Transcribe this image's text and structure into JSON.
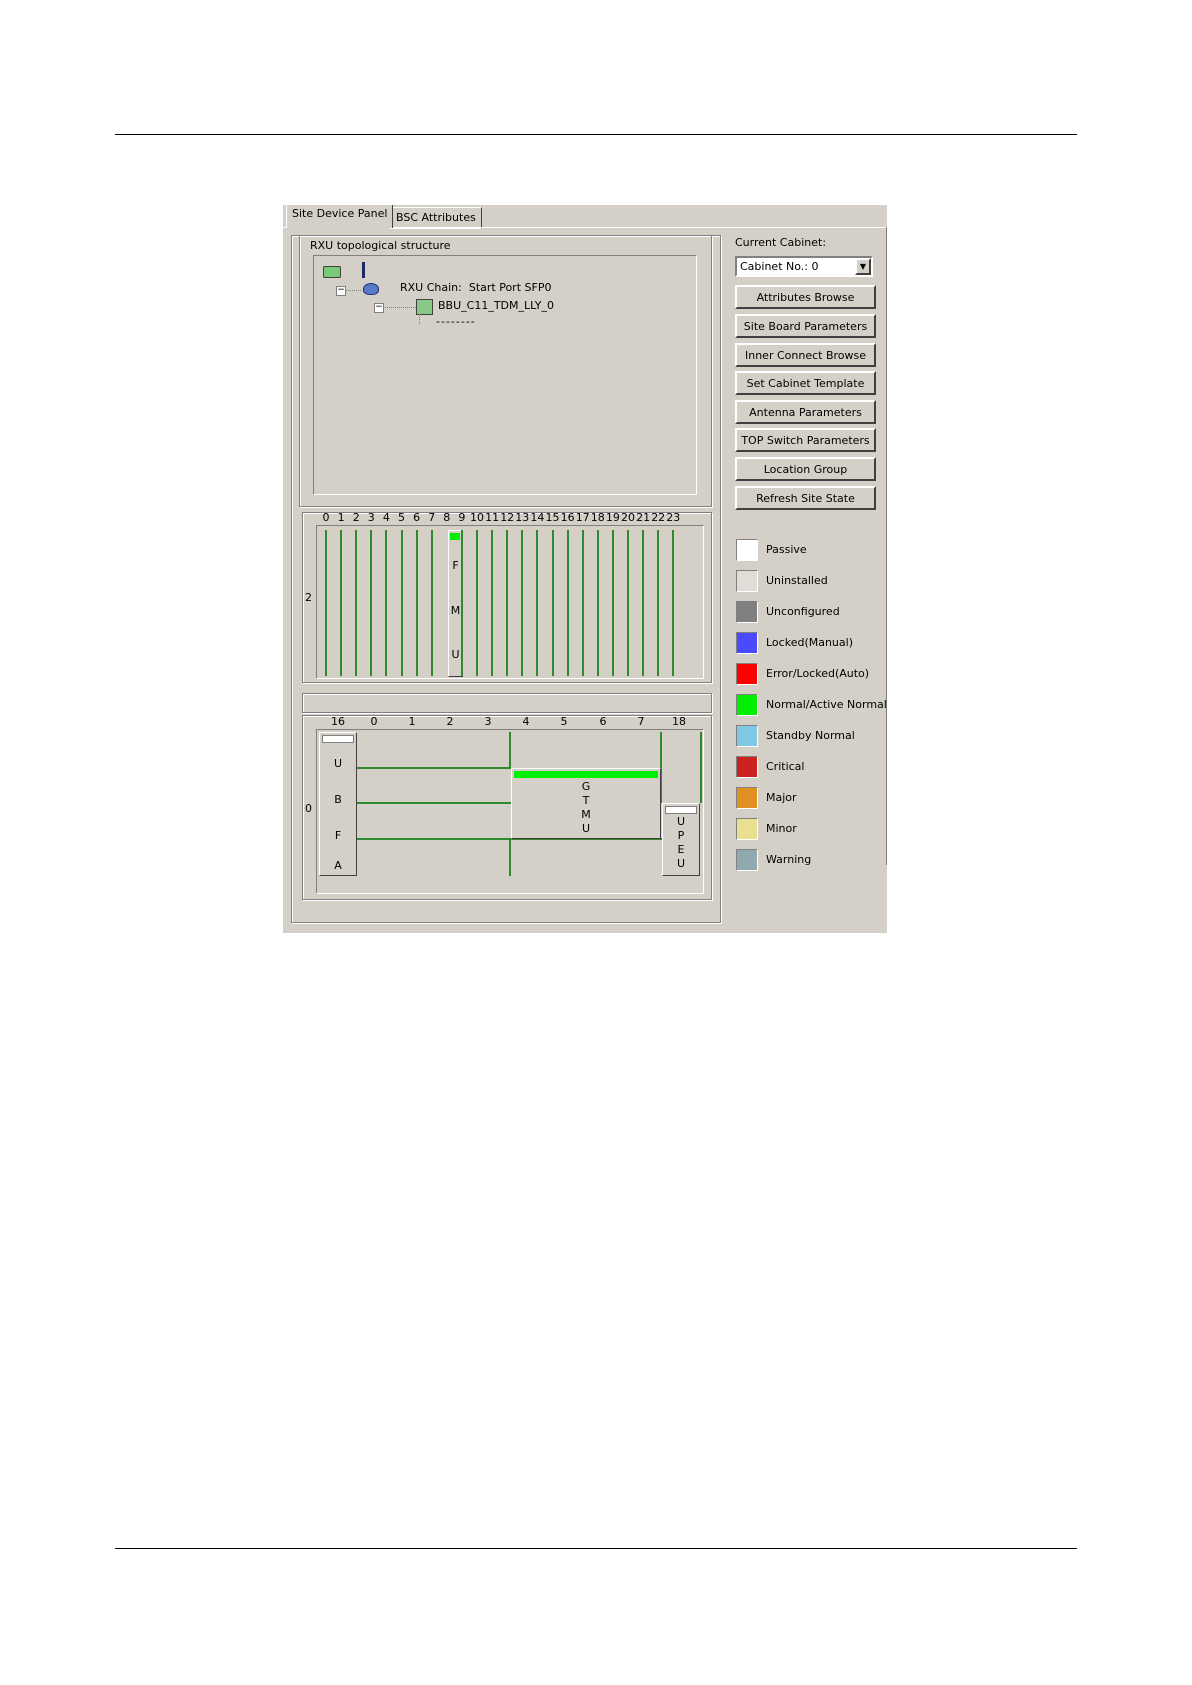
{
  "tabs": [
    "Site Device Panel",
    "BSC Attributes"
  ],
  "topology": {
    "group_title": "RXU topological structure",
    "chain_label": "RXU Chain:  Start Port SFP0",
    "node_label": "BBU_C11_TDM_LLY_0",
    "child_label": "--------"
  },
  "shelf2": {
    "row_label": "2",
    "slots": [
      "0",
      "1",
      "2",
      "3",
      "4",
      "5",
      "6",
      "7",
      "8",
      "9",
      "10",
      "11",
      "12",
      "13",
      "14",
      "15",
      "16",
      "17",
      "18",
      "19",
      "20",
      "21",
      "22",
      "23"
    ],
    "board_letters": [
      "F",
      "M",
      "U"
    ]
  },
  "shelf0": {
    "row_label": "0",
    "slots": [
      "16",
      "0",
      "1",
      "2",
      "3",
      "4",
      "5",
      "6",
      "7",
      "18"
    ],
    "ubfa_letters": [
      "U",
      "B",
      "F",
      "A"
    ],
    "gtmu_letters": [
      "G",
      "T",
      "M",
      "U"
    ],
    "upeu_letters": [
      "U",
      "P",
      "E",
      "U"
    ]
  },
  "side": {
    "current_cabinet_label": "Current Cabinet:",
    "cabinet_select_value": "Cabinet No.: 0",
    "buttons": [
      "Attributes Browse",
      "Site Board Parameters",
      "Inner Connect Browse",
      "Set Cabinet Template",
      "Antenna Parameters",
      "TOP Switch Parameters",
      "Location Group",
      "Refresh  Site State"
    ]
  },
  "legend": [
    {
      "label": "Passive",
      "color": "#ffffff"
    },
    {
      "label": "Uninstalled",
      "color": "#e0dcd6"
    },
    {
      "label": "Unconfigured",
      "color": "#808080"
    },
    {
      "label": "Locked(Manual)",
      "color": "#4a4aff"
    },
    {
      "label": "Error/Locked(Auto)",
      "color": "#ff0000"
    },
    {
      "label": "Normal/Active Normal",
      "color": "#00ee00"
    },
    {
      "label": "Standby Normal",
      "color": "#7ec8e3"
    },
    {
      "label": "Critical",
      "color": "#cc2222"
    },
    {
      "label": "Major",
      "color": "#e09020"
    },
    {
      "label": "Minor",
      "color": "#e8e090"
    },
    {
      "label": "Warning",
      "color": "#90a8b0"
    }
  ],
  "colors": {
    "panel": "#d4d0c8",
    "board_green_line": "#2d8a2d",
    "active_led": "#00ee00"
  }
}
